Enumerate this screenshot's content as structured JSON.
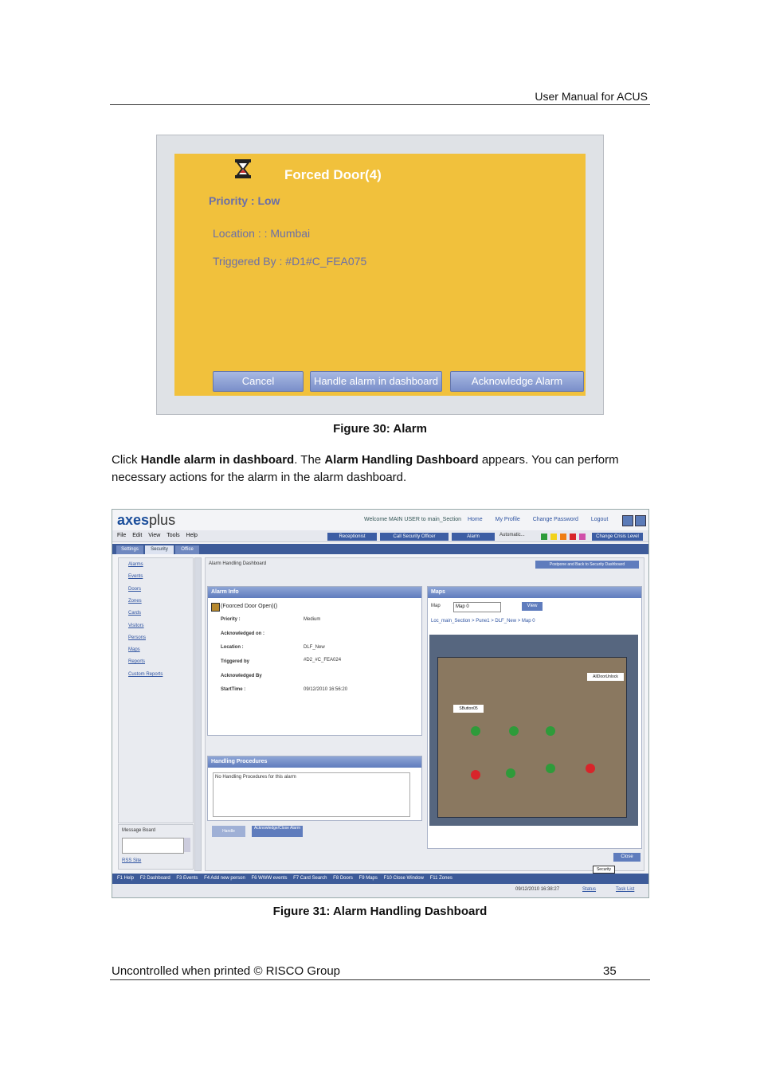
{
  "page": {
    "header_text": "User Manual for ACUS",
    "figure30_caption": "Figure 30: Alarm",
    "paragraph": {
      "p1": "Click ",
      "b1": "Handle alarm in dashboard",
      "p2": ". The ",
      "b2": "Alarm Handling Dashboard",
      "p3": " appears. You can perform necessary actions for the alarm in the alarm dashboard."
    },
    "figure31_caption": "Figure 31: Alarm Handling Dashboard",
    "footer_left": "Uncontrolled when printed © RISCO Group",
    "footer_page": "35"
  },
  "alarm_popup": {
    "title": "Forced Door(4)",
    "priority": "Priority : Low",
    "location": "Location :  : Mumbai",
    "triggered_by": "Triggered By : #D1#C_FEA075",
    "buttons": {
      "cancel": "Cancel",
      "handle": "Handle alarm in dashboard",
      "acknowledge": "Acknowledge Alarm"
    },
    "colors": {
      "background": "#f1c13c",
      "text": "#6b6fa8"
    }
  },
  "dashboard": {
    "logo_a": "axes",
    "logo_b": "plus",
    "welcome": "Welcome MAIN USER  to main_Section",
    "links": [
      "Home",
      "My Profile",
      "Change Password",
      "Logout"
    ],
    "menu": [
      "File",
      "Edit",
      "View",
      "Tools",
      "Help"
    ],
    "toolbar": [
      "Receptionist",
      "Call Security Officer",
      "Alarm",
      "Automatic...",
      "Change Crisis Level"
    ],
    "tabs": [
      "Settings",
      "Security",
      "Office"
    ],
    "sidebar_links": [
      "Alarms",
      "Events",
      "Doors",
      "Zones",
      "Cards",
      "Visitors",
      "Persons",
      "Maps",
      "Reports",
      "Custom Reports"
    ],
    "message_board": "Message Board",
    "rss": "RSS Site",
    "breadcrumb": "Alarm Handling Dashboard",
    "postpone_button": "Postpone and Back to Security Dashboard",
    "alarm_info": {
      "header": "Alarm Info",
      "title": "(Foorced Door Open)()",
      "rows": [
        {
          "label": "Priority :",
          "value": "Medium"
        },
        {
          "label": "Acknowledged on :",
          "value": ""
        },
        {
          "label": "Location :",
          "value": "DLF_New"
        },
        {
          "label": "Triggered by",
          "value": "#D2_#C_FEA024"
        },
        {
          "label": "Acknowledged By",
          "value": ""
        },
        {
          "label": "StartTime :",
          "value": "09/12/2010 16:56:20"
        }
      ]
    },
    "handling": {
      "header": "Handling Procedures",
      "text": "No Handling Procedures for this alarm",
      "btn_handle": "Handle",
      "btn_ack": "Acknowledge/Close Alarm"
    },
    "maps": {
      "header": "Maps",
      "map_label": "Map",
      "map_value": "Map 0",
      "view_button": "View",
      "path": "Loc_main_Section > Pune1 > DLF_New > Map 0",
      "label_button": "SButton05",
      "label_door": "AllDoorUnlock"
    },
    "close_button": "Close",
    "security_tag": "Security",
    "statusbar": [
      "F1 Help",
      "F2 Dashboard",
      "F3 Events",
      "F4 Add new person",
      "F6 WWW events",
      "F7 Card Search",
      "F8 Doors",
      "F9 Maps",
      "F10 Close Window",
      "F11 Zones"
    ],
    "datetime": "09/12/2010    16:38:27",
    "status_link": "Status",
    "task_list": "Task List",
    "alarm_colors": [
      "#2e9b3a",
      "#f2d21a",
      "#ef7d13",
      "#d8242a",
      "#d04fa9"
    ]
  }
}
